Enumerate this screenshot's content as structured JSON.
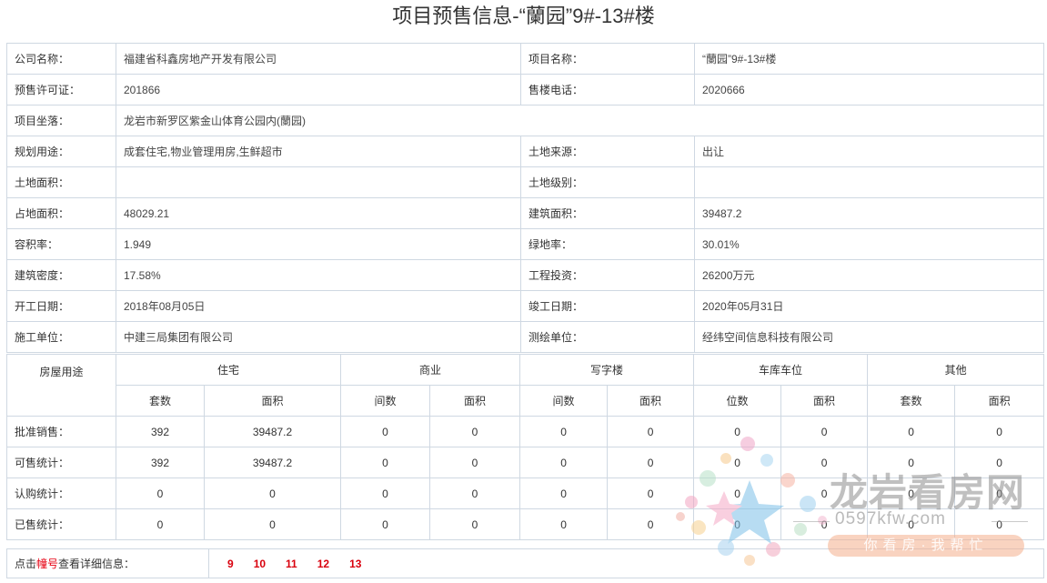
{
  "page": {
    "title": "项目预售信息-“蘭园”9#-13#楼"
  },
  "info": [
    [
      {
        "label": "公司名称：",
        "value": "福建省科鑫房地产开发有限公司"
      },
      {
        "label": "项目名称：",
        "value": "“蘭园”9#-13#楼"
      }
    ],
    [
      {
        "label": "预售许可证：",
        "value": "201866"
      },
      {
        "label": "售楼电话：",
        "value": "2020666"
      }
    ],
    [
      {
        "label": "项目坐落：",
        "value": "龙岩市新罗区紫金山体育公园内(蘭园)"
      }
    ],
    [
      {
        "label": "规划用途：",
        "value": "成套住宅,物业管理用房,生鲜超市"
      },
      {
        "label": "土地来源：",
        "value": "出让"
      }
    ],
    [
      {
        "label": "土地面积：",
        "value": ""
      },
      {
        "label": "土地级别：",
        "value": ""
      }
    ],
    [
      {
        "label": "占地面积：",
        "value": "48029.21"
      },
      {
        "label": "建筑面积：",
        "value": "39487.2"
      }
    ],
    [
      {
        "label": "容积率：",
        "value": "1.949"
      },
      {
        "label": "绿地率：",
        "value": "30.01%"
      }
    ],
    [
      {
        "label": "建筑密度：",
        "value": "17.58%"
      },
      {
        "label": "工程投资：",
        "value": "26200万元"
      }
    ],
    [
      {
        "label": "开工日期：",
        "value": "2018年08月05日"
      },
      {
        "label": "竣工日期：",
        "value": "2020年05月31日"
      }
    ],
    [
      {
        "label": "施工单位：",
        "value": "中建三局集团有限公司"
      },
      {
        "label": "测绘单位：",
        "value": "经纬空间信息科技有限公司"
      }
    ]
  ],
  "stats": {
    "corner": "房屋用途",
    "groups": [
      {
        "name": "住宅",
        "sub": [
          "套数",
          "面积"
        ]
      },
      {
        "name": "商业",
        "sub": [
          "间数",
          "面积"
        ]
      },
      {
        "name": "写字楼",
        "sub": [
          "间数",
          "面积"
        ]
      },
      {
        "name": "车库车位",
        "sub": [
          "位数",
          "面积"
        ]
      },
      {
        "name": "其他",
        "sub": [
          "套数",
          "面积"
        ]
      }
    ],
    "rows": [
      {
        "label": "批准销售：",
        "values": [
          "392",
          "39487.2",
          "0",
          "0",
          "0",
          "0",
          "0",
          "0",
          "0",
          "0"
        ]
      },
      {
        "label": "可售统计：",
        "values": [
          "392",
          "39487.2",
          "0",
          "0",
          "0",
          "0",
          "0",
          "0",
          "0",
          "0"
        ]
      },
      {
        "label": "认购统计：",
        "values": [
          "0",
          "0",
          "0",
          "0",
          "0",
          "0",
          "0",
          "0",
          "0",
          "0"
        ]
      },
      {
        "label": "已售统计：",
        "values": [
          "0",
          "0",
          "0",
          "0",
          "0",
          "0",
          "0",
          "0",
          "0",
          "0"
        ]
      }
    ]
  },
  "links": {
    "hint_pre": "点击",
    "hint_hl": "幢号",
    "hint_post": "查看详细信息：",
    "buildings": [
      "9",
      "10",
      "11",
      "12",
      "13"
    ]
  },
  "watermark": {
    "brand": "龙岩看房网",
    "url": "0597kfw.com",
    "slogan": "你看房·我帮忙"
  },
  "colors": {
    "border": "#cfd8e2",
    "link_red": "#d9000d",
    "highlight": "#e60012"
  }
}
